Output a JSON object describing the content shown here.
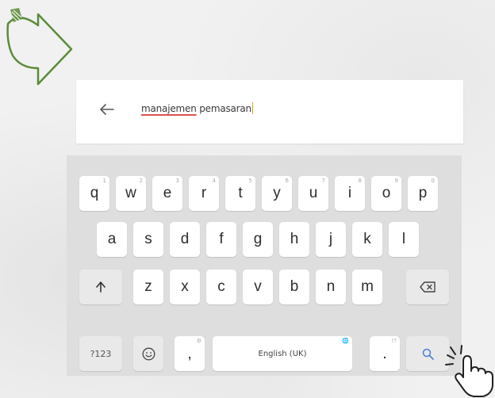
{
  "search": {
    "query_underlined": "manajemen",
    "query_rest": " pemasaran"
  },
  "keyboard": {
    "rows": [
      [
        {
          "label": "q",
          "hint": "1"
        },
        {
          "label": "w",
          "hint": "2"
        },
        {
          "label": "e",
          "hint": "3"
        },
        {
          "label": "r",
          "hint": "4"
        },
        {
          "label": "t",
          "hint": "5"
        },
        {
          "label": "y",
          "hint": "6"
        },
        {
          "label": "u",
          "hint": "7"
        },
        {
          "label": "i",
          "hint": "8"
        },
        {
          "label": "o",
          "hint": "9"
        },
        {
          "label": "p",
          "hint": "0"
        }
      ],
      [
        {
          "label": "a"
        },
        {
          "label": "s"
        },
        {
          "label": "d"
        },
        {
          "label": "f"
        },
        {
          "label": "g"
        },
        {
          "label": "h"
        },
        {
          "label": "j"
        },
        {
          "label": "k"
        },
        {
          "label": "l"
        }
      ],
      [
        {
          "label": "z"
        },
        {
          "label": "x"
        },
        {
          "label": "c"
        },
        {
          "label": "v"
        },
        {
          "label": "b"
        },
        {
          "label": "n"
        },
        {
          "label": "m"
        }
      ]
    ],
    "symbols_label": "?123",
    "comma_label": ",",
    "comma_hint": "⚙",
    "space_label": "English (UK)",
    "space_hint": "🌐",
    "period_label": ".",
    "period_hint": "!?",
    "icons": {
      "shift": "shift-arrow-icon",
      "backspace": "backspace-icon",
      "emoji": "emoji-smiley-icon",
      "search": "search-icon"
    }
  },
  "colors": {
    "accent_arrow": "#5b8c3a",
    "search_key_icon": "#4a7fd8",
    "spellcheck_underline": "#d9534f",
    "keyboard_bg": "#dedede"
  }
}
